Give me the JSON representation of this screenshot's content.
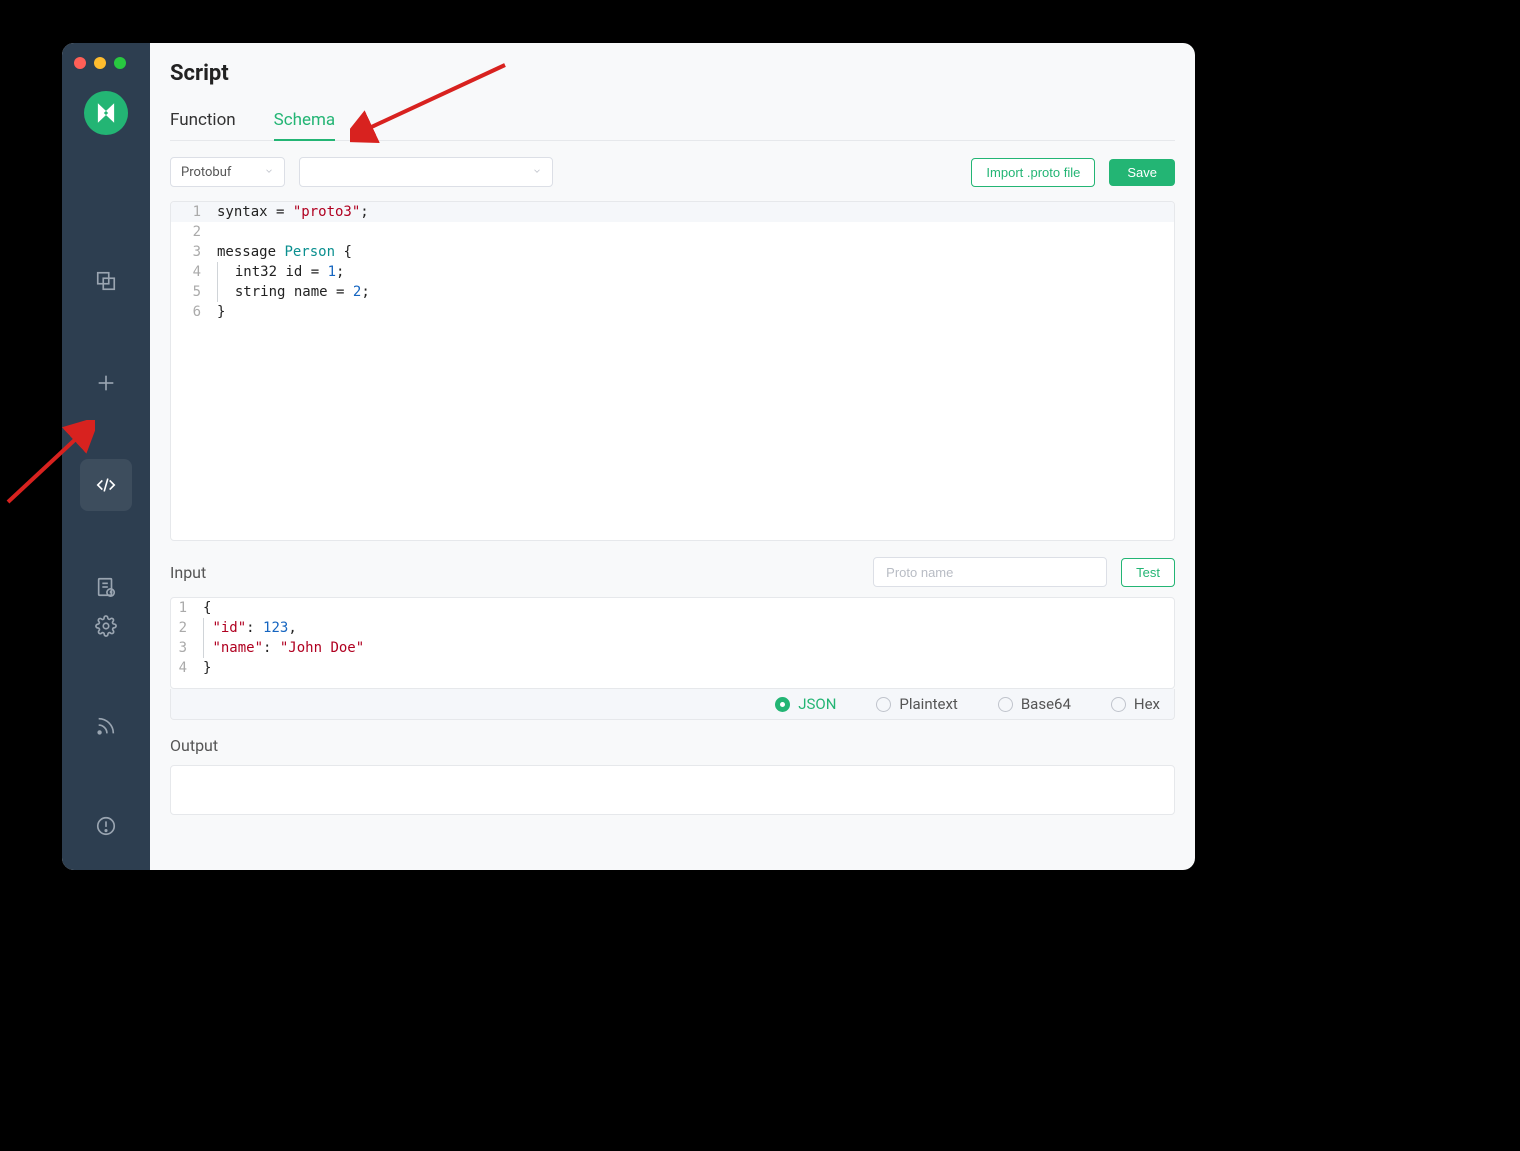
{
  "page": {
    "title": "Script"
  },
  "tabs": {
    "function": "Function",
    "schema": "Schema",
    "active": "schema"
  },
  "toolbar": {
    "format_select": "Protobuf",
    "import_btn": "Import .proto file",
    "save_btn": "Save"
  },
  "schema_code": {
    "lines": [
      {
        "n": "1",
        "segs": [
          [
            "kw",
            "syntax = "
          ],
          [
            "str",
            "\"proto3\""
          ],
          [
            "kw",
            ";"
          ]
        ]
      },
      {
        "n": "2",
        "segs": []
      },
      {
        "n": "3",
        "segs": [
          [
            "kw",
            "message "
          ],
          [
            "ident",
            "Person"
          ],
          [
            "kw",
            " {"
          ]
        ]
      },
      {
        "n": "4",
        "segs": [
          [
            "indent",
            ""
          ],
          [
            "kw",
            " int32 id = "
          ],
          [
            "num",
            "1"
          ],
          [
            "kw",
            ";"
          ]
        ]
      },
      {
        "n": "5",
        "segs": [
          [
            "indent",
            ""
          ],
          [
            "kw",
            " string name = "
          ],
          [
            "num",
            "2"
          ],
          [
            "kw",
            ";"
          ]
        ]
      },
      {
        "n": "6",
        "segs": [
          [
            "kw",
            "}"
          ]
        ]
      }
    ]
  },
  "input": {
    "title": "Input",
    "proto_name_placeholder": "Proto name",
    "test_btn": "Test",
    "code_lines": [
      {
        "n": "1",
        "segs": [
          [
            "kw",
            "{"
          ]
        ]
      },
      {
        "n": "2",
        "segs": [
          [
            "indent",
            ""
          ],
          [
            "prop",
            "\"id\""
          ],
          [
            "kw",
            ": "
          ],
          [
            "num",
            "123"
          ],
          [
            "kw",
            ","
          ]
        ]
      },
      {
        "n": "3",
        "segs": [
          [
            "indent",
            ""
          ],
          [
            "prop",
            "\"name\""
          ],
          [
            "kw",
            ": "
          ],
          [
            "str",
            "\"John Doe\""
          ]
        ]
      },
      {
        "n": "4",
        "segs": [
          [
            "kw",
            "}"
          ]
        ]
      }
    ],
    "formats": {
      "json": "JSON",
      "plaintext": "Plaintext",
      "base64": "Base64",
      "hex": "Hex",
      "selected": "json"
    }
  },
  "output": {
    "title": "Output"
  }
}
